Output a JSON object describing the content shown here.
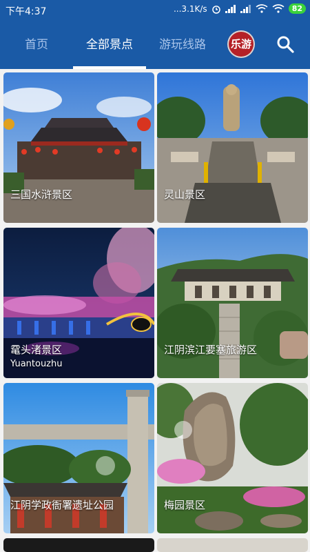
{
  "status_bar": {
    "time": "下午4:37",
    "network_speed": "...3.1K/s",
    "battery": "82"
  },
  "nav": {
    "tabs": [
      {
        "label": "首页",
        "active": false
      },
      {
        "label": "全部景点",
        "active": true
      },
      {
        "label": "游玩线路",
        "active": false
      }
    ],
    "logo_text": "乐游",
    "search_icon": "search-icon"
  },
  "cards": [
    {
      "title": "三国水浒景区",
      "subtitle": ""
    },
    {
      "title": "灵山景区",
      "subtitle": ""
    },
    {
      "title": "鼋头渚景区",
      "subtitle": "Yuantouzhu"
    },
    {
      "title": "江阴滨江要塞旅游区",
      "subtitle": ""
    },
    {
      "title": "江阴学政衙署遗址公园",
      "subtitle": ""
    },
    {
      "title": "梅园景区",
      "subtitle": ""
    }
  ],
  "colors": {
    "header_bg": "#1a5aa6",
    "tab_inactive": "#a9c4ea",
    "tab_active": "#ffffff",
    "battery": "#3bd23b",
    "logo_badge": "#b52127"
  }
}
